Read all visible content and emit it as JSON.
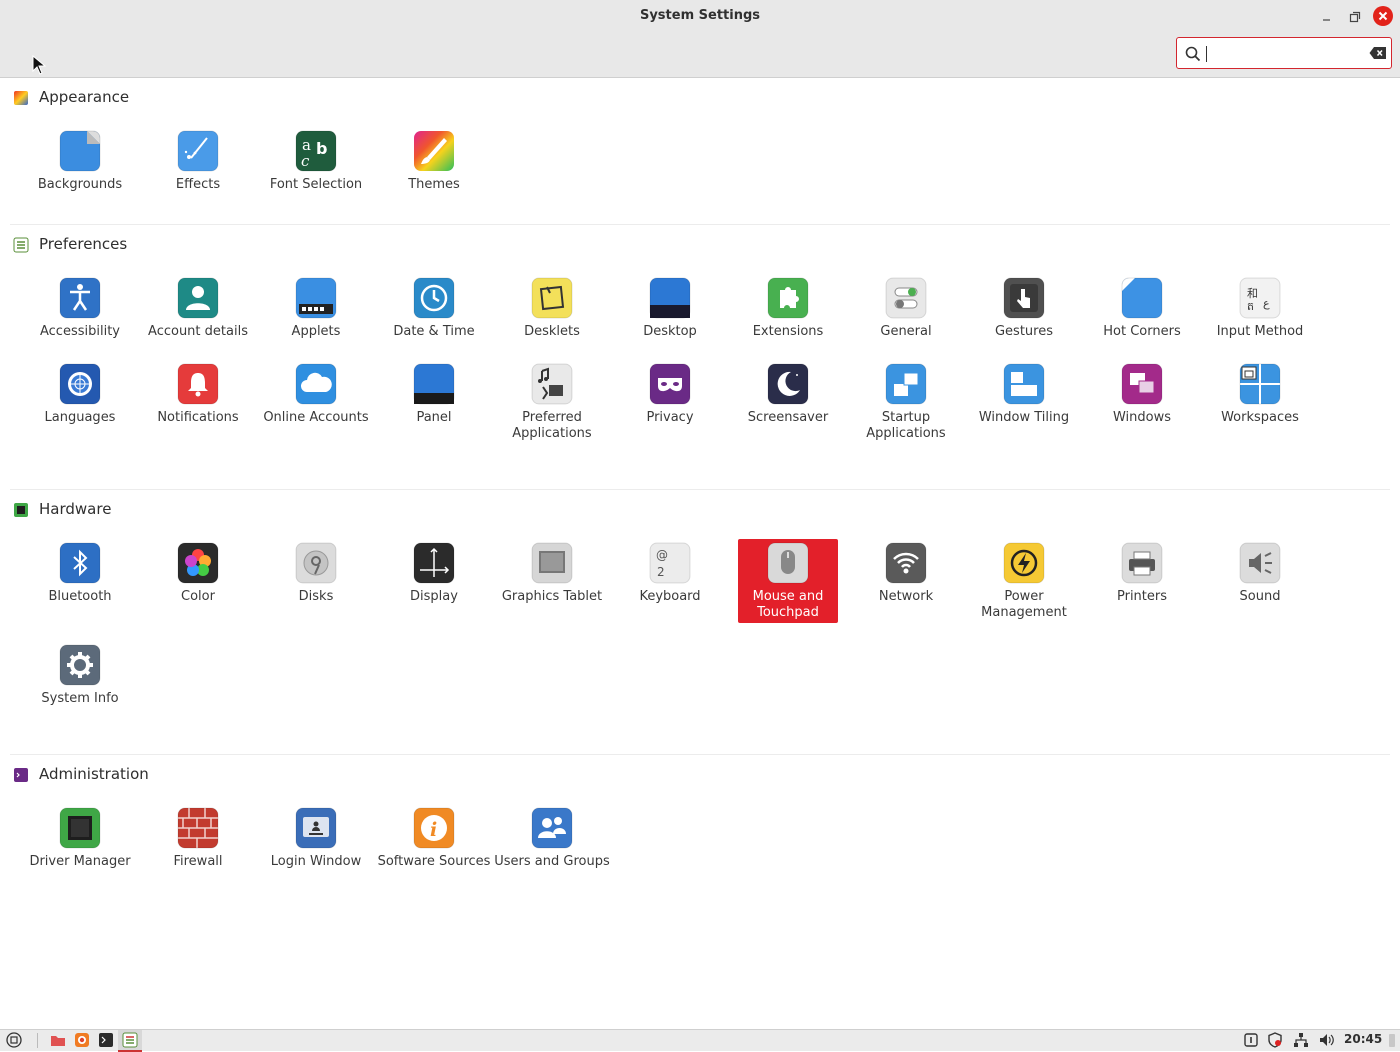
{
  "window": {
    "title": "System Settings"
  },
  "search": {
    "value": "",
    "placeholder": ""
  },
  "sections": [
    {
      "id": "appearance",
      "title": "Appearance",
      "items": [
        {
          "label": "Backgrounds",
          "icon": "backgrounds-icon"
        },
        {
          "label": "Effects",
          "icon": "effects-icon"
        },
        {
          "label": "Font Selection",
          "icon": "font-selection-icon"
        },
        {
          "label": "Themes",
          "icon": "themes-icon"
        }
      ]
    },
    {
      "id": "preferences",
      "title": "Preferences",
      "items": [
        {
          "label": "Accessibility",
          "icon": "accessibility-icon"
        },
        {
          "label": "Account details",
          "icon": "account-details-icon"
        },
        {
          "label": "Applets",
          "icon": "applets-icon"
        },
        {
          "label": "Date & Time",
          "icon": "clock-icon"
        },
        {
          "label": "Desklets",
          "icon": "desklets-icon"
        },
        {
          "label": "Desktop",
          "icon": "desktop-icon"
        },
        {
          "label": "Extensions",
          "icon": "puzzle-icon"
        },
        {
          "label": "General",
          "icon": "toggles-icon"
        },
        {
          "label": "Gestures",
          "icon": "hand-icon"
        },
        {
          "label": "Hot Corners",
          "icon": "hot-corners-icon"
        },
        {
          "label": "Input Method",
          "icon": "input-method-icon"
        },
        {
          "label": "Languages",
          "icon": "globe-icon"
        },
        {
          "label": "Notifications",
          "icon": "bell-icon"
        },
        {
          "label": "Online Accounts",
          "icon": "cloud-icon"
        },
        {
          "label": "Panel",
          "icon": "panel-icon"
        },
        {
          "label": "Preferred Applications",
          "icon": "preferred-apps-icon"
        },
        {
          "label": "Privacy",
          "icon": "mask-icon"
        },
        {
          "label": "Screensaver",
          "icon": "moon-icon"
        },
        {
          "label": "Startup Applications",
          "icon": "startup-icon"
        },
        {
          "label": "Window Tiling",
          "icon": "window-tiling-icon"
        },
        {
          "label": "Windows",
          "icon": "windows-icon"
        },
        {
          "label": "Workspaces",
          "icon": "workspaces-icon"
        }
      ]
    },
    {
      "id": "hardware",
      "title": "Hardware",
      "items": [
        {
          "label": "Bluetooth",
          "icon": "bluetooth-icon"
        },
        {
          "label": "Color",
          "icon": "color-icon"
        },
        {
          "label": "Disks",
          "icon": "disk-icon"
        },
        {
          "label": "Display",
          "icon": "display-icon"
        },
        {
          "label": "Graphics Tablet",
          "icon": "tablet-icon"
        },
        {
          "label": "Keyboard",
          "icon": "keyboard-icon"
        },
        {
          "label": "Mouse and Touchpad",
          "icon": "mouse-icon",
          "selected": true
        },
        {
          "label": "Network",
          "icon": "wifi-icon"
        },
        {
          "label": "Power Management",
          "icon": "power-icon"
        },
        {
          "label": "Printers",
          "icon": "printer-icon"
        },
        {
          "label": "Sound",
          "icon": "speaker-icon"
        },
        {
          "label": "System Info",
          "icon": "gear-icon"
        }
      ]
    },
    {
      "id": "administration",
      "title": "Administration",
      "items": [
        {
          "label": "Driver Manager",
          "icon": "chip-icon"
        },
        {
          "label": "Firewall",
          "icon": "firewall-icon"
        },
        {
          "label": "Login Window",
          "icon": "login-window-icon"
        },
        {
          "label": "Software Sources",
          "icon": "info-icon"
        },
        {
          "label": "Users and Groups",
          "icon": "users-icon"
        }
      ]
    }
  ],
  "taskbar": {
    "clock": "20:45"
  },
  "colors": {
    "accent": "#e3202a",
    "titlebar": "#e8e8e8"
  }
}
